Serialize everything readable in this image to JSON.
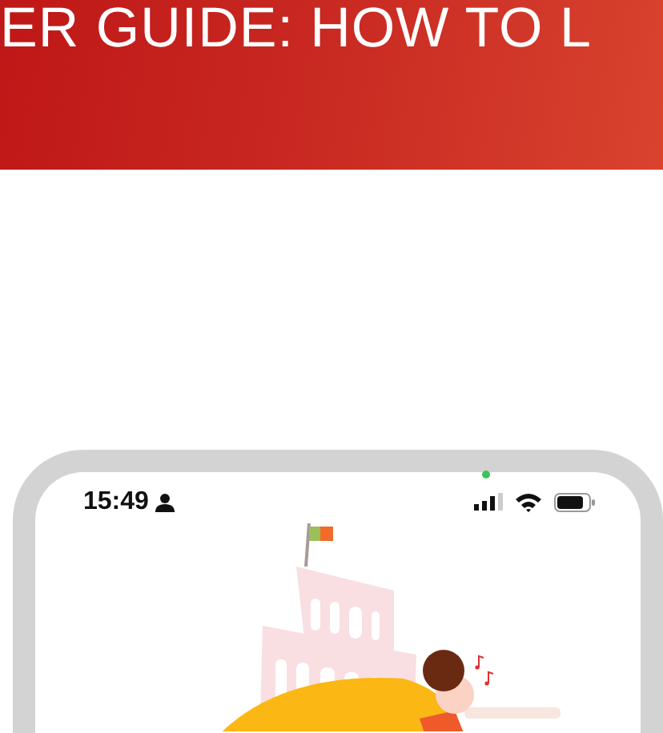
{
  "banner": {
    "title": "ER GUIDE: HOW TO L"
  },
  "phone": {
    "status_bar": {
      "time": "15:49"
    }
  }
}
